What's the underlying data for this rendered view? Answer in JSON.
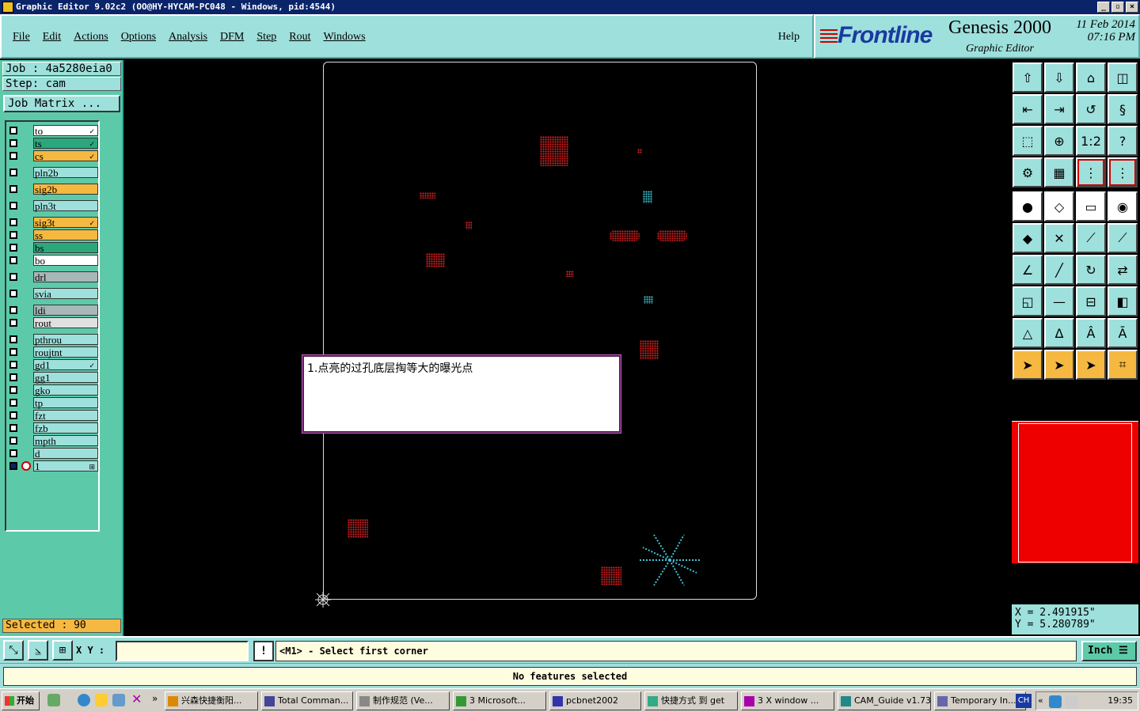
{
  "window": {
    "title": "Graphic Editor 9.02c2 (OO@HY-HYCAM-PC048 - Windows, pid:4544)"
  },
  "menu": {
    "items": [
      "File",
      "Edit",
      "Actions",
      "Options",
      "Analysis",
      "DFM",
      "Step",
      "Rout",
      "Windows"
    ],
    "help": "Help"
  },
  "brand": {
    "logo": "Frontline",
    "product": "Genesis 2000",
    "subtitle": "Graphic Editor",
    "date": "11 Feb 2014",
    "time": "07:16 PM"
  },
  "job": {
    "job_line": "Job : 4a5280eia0",
    "step_line": "Step: cam",
    "matrix_button": "Job Matrix ..."
  },
  "layers": [
    {
      "name": "to",
      "color": "#ffffff",
      "mark": "✓"
    },
    {
      "name": "ts",
      "color": "#2aa87c",
      "mark": "✓"
    },
    {
      "name": "cs",
      "color": "#f5b840",
      "mark": "✓"
    },
    {
      "name": "pln2b",
      "color": "#9ee0dc",
      "mark": ""
    },
    {
      "name": "sig2b",
      "color": "#f5b840",
      "mark": ""
    },
    {
      "name": "pln3t",
      "color": "#9ee0dc",
      "mark": ""
    },
    {
      "name": "sig3t",
      "color": "#f5b840",
      "mark": "✓"
    },
    {
      "name": "ss",
      "color": "#f5b840",
      "mark": ""
    },
    {
      "name": "bs",
      "color": "#2aa87c",
      "mark": ""
    },
    {
      "name": "bo",
      "color": "#ffffff",
      "mark": ""
    },
    {
      "name": "drl",
      "color": "#a8b8b8",
      "mark": ""
    },
    {
      "name": "svia",
      "color": "#9ee0dc",
      "mark": ""
    },
    {
      "name": "ldi",
      "color": "#a8b8b8",
      "mark": ""
    },
    {
      "name": "rout",
      "color": "#e0e0e0",
      "mark": ""
    },
    {
      "name": "pthrou",
      "color": "#9ee0dc",
      "mark": ""
    },
    {
      "name": "roujtnt",
      "color": "#9ee0dc",
      "mark": ""
    },
    {
      "name": "gd1",
      "color": "#9ee0dc",
      "mark": "✓"
    },
    {
      "name": "gg1",
      "color": "#9ee0dc",
      "mark": ""
    },
    {
      "name": "gko",
      "color": "#9ee0dc",
      "mark": ""
    },
    {
      "name": "tp",
      "color": "#9ee0dc",
      "mark": ""
    },
    {
      "name": "fzt",
      "color": "#9ee0dc",
      "mark": ""
    },
    {
      "name": "fzb",
      "color": "#9ee0dc",
      "mark": ""
    },
    {
      "name": "mpth",
      "color": "#9ee0dc",
      "mark": ""
    },
    {
      "name": "d",
      "color": "#9ee0dc",
      "mark": ""
    },
    {
      "name": "1",
      "color": "#9ee0dc",
      "mark": "⊞"
    }
  ],
  "selected": "Selected : 90",
  "popup": {
    "message": "1.点亮的过孔底层掏等大的曝光点"
  },
  "coords": {
    "x": "X = 2.491915\"",
    "y": "Y = 5.280789\""
  },
  "command": {
    "xy_label": "X Y :",
    "xy_value": "",
    "prompt_icon": "!",
    "prompt": "<M1> - Select first corner",
    "units": "Inch"
  },
  "status": {
    "message": "No features selected"
  },
  "taskbar": {
    "start": "开始",
    "tasks": [
      "兴森快捷衡阳...",
      "Total Comman...",
      "制作规范 (Ve...",
      "3 Microsoft...",
      "pcbnet2002",
      "快捷方式 到 get",
      "3 X window ...",
      "CAM_Guide v1.73",
      "Temporary In..."
    ],
    "lang": "CH",
    "clock": "19:35"
  },
  "colors": {
    "panel": "#9ee0dc",
    "layer_bg": "#5ccaa8",
    "feature_red": "#e02020",
    "feature_cyan": "#3ec8d8",
    "overview": "#ee0000"
  }
}
